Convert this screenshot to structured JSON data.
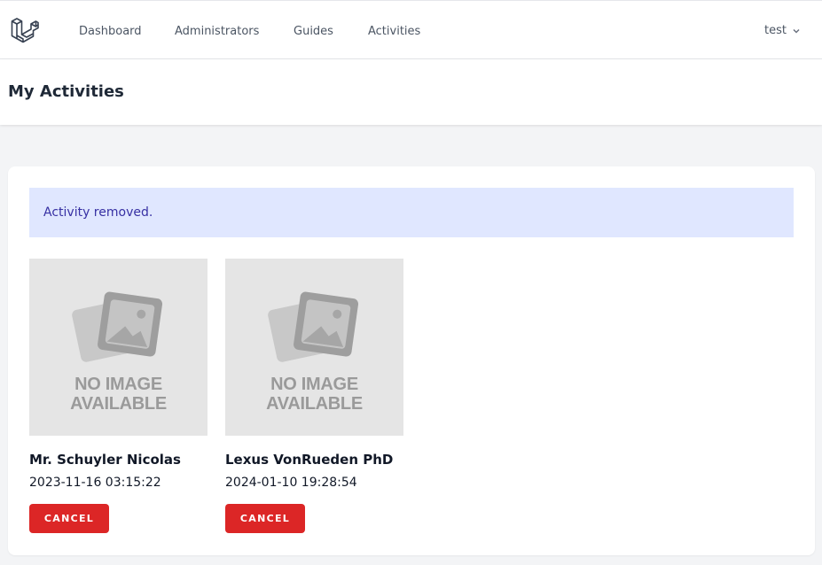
{
  "nav": {
    "logo_icon": "laravel-logo",
    "links": [
      {
        "label": "Dashboard"
      },
      {
        "label": "Administrators"
      },
      {
        "label": "Guides"
      },
      {
        "label": "Activities"
      }
    ],
    "user": {
      "name": "test",
      "icon": "chevron-down-icon"
    }
  },
  "header": {
    "title": "My Activities"
  },
  "alert": {
    "message": "Activity removed."
  },
  "activities": [
    {
      "image_placeholder": {
        "line1": "NO IMAGE",
        "line2": "AVAILABLE"
      },
      "name": "Mr. Schuyler Nicolas",
      "date": "2023-11-16 03:15:22",
      "action_label": "CANCEL"
    },
    {
      "image_placeholder": {
        "line1": "NO IMAGE",
        "line2": "AVAILABLE"
      },
      "name": "Lexus VonRueden PhD",
      "date": "2024-01-10 19:28:54",
      "action_label": "CANCEL"
    }
  ],
  "colors": {
    "accent_button": "#dc2626",
    "alert_bg": "#e0e7ff",
    "alert_text": "#3730a3"
  }
}
